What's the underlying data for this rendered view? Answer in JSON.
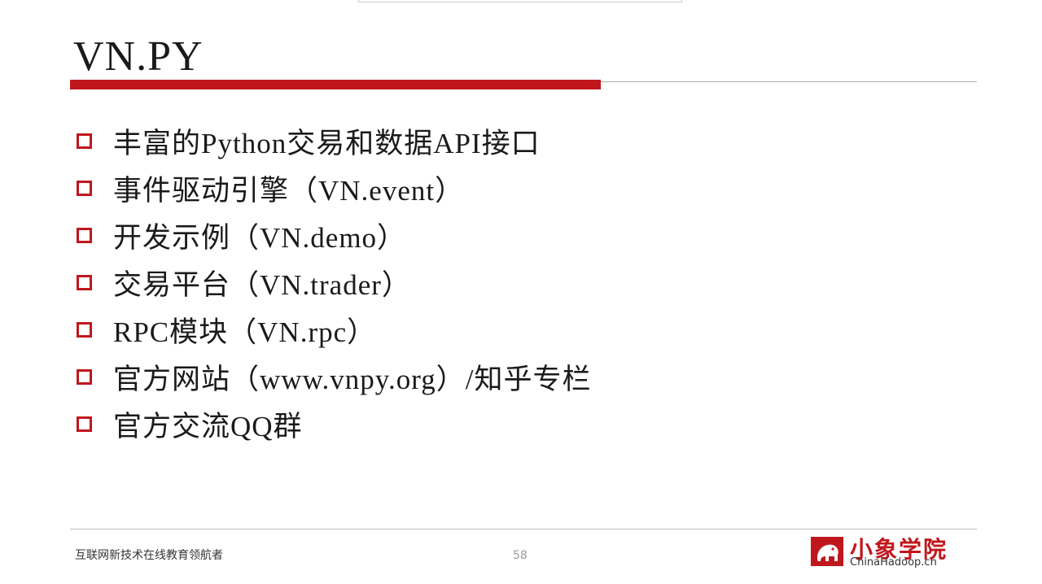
{
  "slide": {
    "title": "VN.PY",
    "bullets": [
      "丰富的Python交易和数据API接口",
      "事件驱动引擎（VN.event）",
      "开发示例（VN.demo）",
      "交易平台（VN.trader）",
      "RPC模块（VN.rpc）",
      "官方网站（www.vnpy.org）/知乎专栏",
      "官方交流QQ群"
    ]
  },
  "footer": {
    "tagline": "互联网新技术在线教育领航者",
    "page_number": "58",
    "logo_cn": "小象学院",
    "logo_en": "ChinaHadoop.cn"
  },
  "colors": {
    "accent": "#c0171d",
    "text": "#1a1a1a"
  }
}
